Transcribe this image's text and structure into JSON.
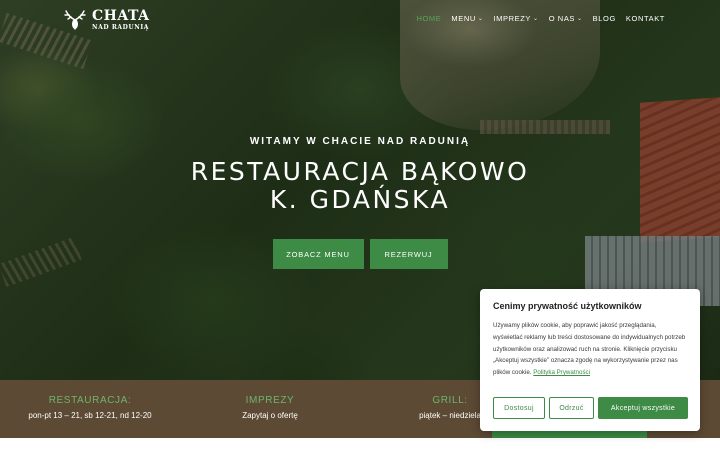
{
  "header": {
    "logo": {
      "big": "CHATA",
      "small": "NAD RADUNIĄ"
    },
    "nav": [
      {
        "label": "HOME",
        "active": true,
        "dropdown": false
      },
      {
        "label": "MENU",
        "active": false,
        "dropdown": true
      },
      {
        "label": "IMPREZY",
        "active": false,
        "dropdown": true
      },
      {
        "label": "O NAS",
        "active": false,
        "dropdown": true
      },
      {
        "label": "BLOG",
        "active": false,
        "dropdown": false
      },
      {
        "label": "KONTAKT",
        "active": false,
        "dropdown": false
      }
    ]
  },
  "hero": {
    "welcome": "WITAMY W CHACIE NAD RADUNIĄ",
    "title_line1": "RESTAURACJA BĄKOWO",
    "title_line2": "K. GDAŃSKA",
    "menu_button": "ZOBACZ MENU",
    "book_button": "REZERWUJ"
  },
  "info_bar": [
    {
      "heading": "RESTAURACJA:",
      "text": "pon-pt 13 – 21, sb 12-21, nd 12-20"
    },
    {
      "heading": "IMPREZY",
      "text": "Zapytaj o ofertę"
    },
    {
      "heading": "GRILL:",
      "text": "piątek – niedziela"
    }
  ],
  "cookie": {
    "title": "Cenimy prywatność użytkowników",
    "body": "Używamy plików cookie, aby poprawić jakość przeglądania, wyświetlać reklamy lub treści dostosowane do indywidualnych potrzeb użytkowników oraz analizować ruch na stronie. Kliknięcie przycisku „Akceptuj wszystkie” oznacza zgodę na wykorzystywanie przez nas plików cookie.",
    "link": "Polityka Prywatności",
    "buttons": {
      "customize": "Dostosuj",
      "reject": "Odrzuć",
      "accept": "Akceptuj wszystkie"
    }
  },
  "colors": {
    "accent": "#3d8b45",
    "info_bar_bg": "#5d4a34",
    "info_heading": "#6fb36d"
  }
}
